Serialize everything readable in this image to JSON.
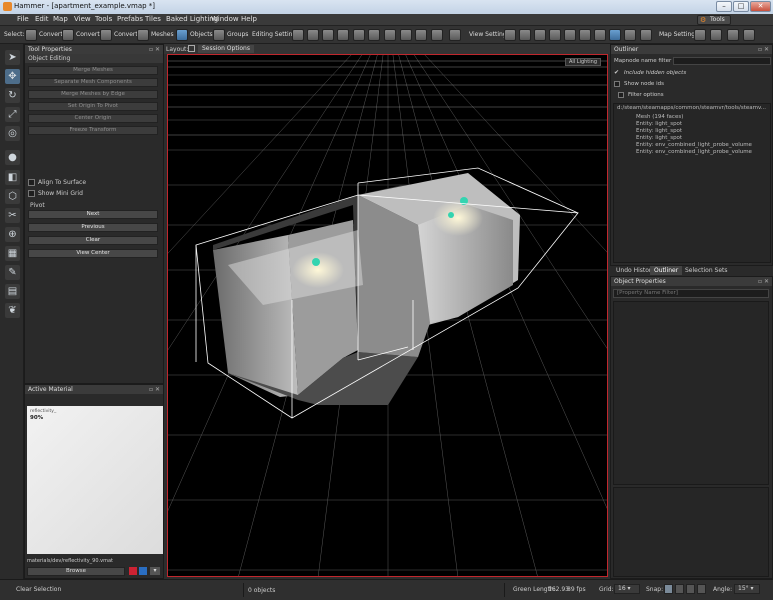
{
  "window": {
    "title": "Hammer - [apartment_example.vmap *]",
    "minimize": "–",
    "maximize": "□",
    "close": "✕"
  },
  "menu": [
    "File",
    "Edit",
    "Map",
    "View",
    "Tools",
    "Prefabs",
    "Tiles",
    "Baked Lighting",
    "Window",
    "Help"
  ],
  "tools_button": "Tools",
  "toolbar": {
    "select_label": "Select:",
    "convert1": "Convert",
    "convert2": "Convert",
    "convert3": "Convert",
    "meshes": "Meshes",
    "objects": "Objects",
    "groups": "Groups",
    "editing_settings": "Editing Settings:",
    "view_settings": "View Settings:",
    "map_settings": "Map Settings:"
  },
  "tool_properties": {
    "header": "Tool Properties",
    "section": "Object Editing",
    "buttons": [
      "Merge Meshes",
      "Separate Mesh Components",
      "Merge Meshes by Edge",
      "Set Origin To Pivot",
      "Center Origin",
      "Freeze Transform"
    ],
    "align_to_surface": "Align To Surface",
    "show_mini_grid": "Show Mini Grid",
    "pivot_label": "Pivot",
    "pivot_buttons": [
      "Next",
      "Previous",
      "Clear",
      "View Center"
    ]
  },
  "active_material": {
    "header": "Active Material",
    "preview_label": "reflectivity_",
    "preview_value": "90%",
    "path": "materials/dev/reflectivity_90.vmat",
    "browse": "Browse"
  },
  "viewport": {
    "layout_label": "Layout:",
    "session_options": "Session Options",
    "render_mode": "All Lighting",
    "bg_color": "#000000",
    "border_color": "#c1272d"
  },
  "outliner": {
    "header": "Outliner",
    "filter_label": "Mapnode name filter",
    "include_hidden": "Include hidden objects",
    "show_node_ids": "Show node ids",
    "filter_options": "Filter options",
    "root": "d:/steam/steamapps/common/steamvr/tools/steamv...",
    "items": [
      "Mesh (194 faces)",
      "Entity: light_spot",
      "Entity: light_spot",
      "Entity: light_spot",
      "Entity: env_combined_light_probe_volume",
      "Entity: env_combined_light_probe_volume"
    ]
  },
  "right_tabs": [
    "Undo History",
    "Outliner",
    "Selection Sets"
  ],
  "object_properties": {
    "header": "Object Properties",
    "filter_placeholder": "[Property Name Filter]"
  },
  "status": {
    "clear_selection": "Clear Selection",
    "selected": "0 objects",
    "green_length_label": "Green Length:",
    "green_length_value": "162.93",
    "fps": "89 fps",
    "grid_label": "Grid:",
    "grid_value": "16",
    "snap_label": "Snap:",
    "angle_label": "Angle:",
    "angle_value": "15°"
  }
}
